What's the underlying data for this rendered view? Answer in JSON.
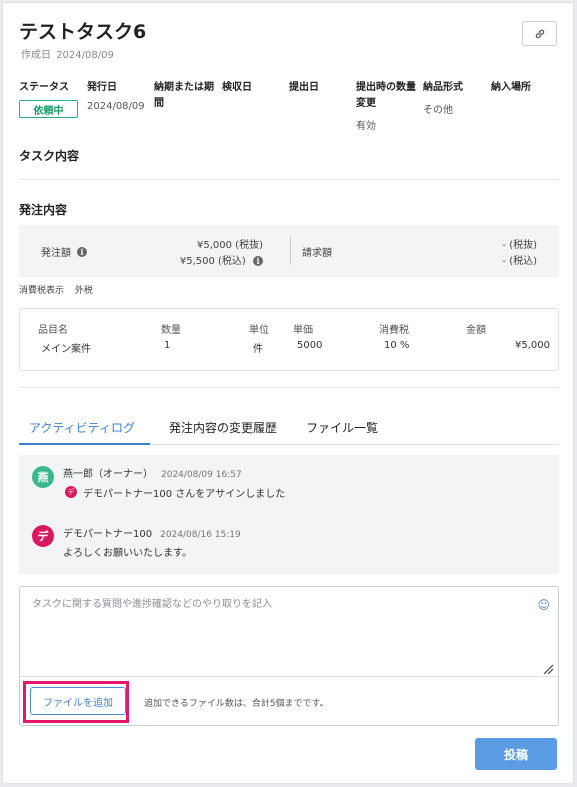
{
  "header": {
    "title": "テストタスク6",
    "created_label": "作成日",
    "created_date": "2024/08/09"
  },
  "meta": {
    "status_label": "ステータス",
    "status_value": "依頼中",
    "issue_date_label": "発行日",
    "issue_date_value": "2024/08/09",
    "due_label_1": "納期または期",
    "due_label_2": "間",
    "inspection_label": "検収日",
    "submit_date_label": "提出日",
    "submit_qty_label_1": "提出時の数量",
    "submit_qty_label_2": "変更",
    "submit_qty_value": "有効",
    "delivery_format_label": "納品形式",
    "delivery_format_value": "その他",
    "delivery_place_label": "納入場所"
  },
  "sections": {
    "task_content": "タスク内容",
    "order_content": "発注内容"
  },
  "order": {
    "amount_label": "発注額",
    "amount_excl": "¥5,000 (税抜)",
    "amount_incl": "¥5,500 (税込)",
    "claim_label": "請求額",
    "claim_excl": "- (税抜)",
    "claim_incl": "- (税込)",
    "tax_display_label": "消費税表示",
    "tax_display_value": "外税"
  },
  "items_table": {
    "headers": [
      "品目名",
      "数量",
      "単位",
      "単価",
      "消費税",
      "金額"
    ],
    "rows": [
      [
        "メイン案件",
        "1",
        "件",
        "5000",
        "10 %",
        "¥5,000"
      ]
    ]
  },
  "tabs": [
    "アクティビティログ",
    "発注内容の変更履歴",
    "ファイル一覧"
  ],
  "activity": [
    {
      "avatar": "燕",
      "avatar_color": "#3cb98a",
      "author": "燕一郎（オーナー）",
      "time": "2024/08/09 16:57",
      "sub_avatar": "デ",
      "sub_avatar_color": "#d8195f",
      "message": "デモパートナー100 さんをアサインしました"
    },
    {
      "avatar": "デ",
      "avatar_color": "#d8195f",
      "author": "デモパートナー100",
      "time": "2024/08/16 15:19",
      "message": "よろしくお願いいたします。"
    }
  ],
  "compose": {
    "placeholder": "タスクに関する質問や進捗確認などのやり取りを記入",
    "value": "",
    "add_file_label": "ファイルを追加",
    "file_note": "追加できるファイル数は、合計5個までです。",
    "emoji_icon": "smile-icon"
  },
  "post_label": "投稿",
  "colors": {
    "accent": "#3d7fd1",
    "status": "#1a9b6a",
    "highlight": "#e6166c",
    "post_button": "#5b9be3"
  }
}
